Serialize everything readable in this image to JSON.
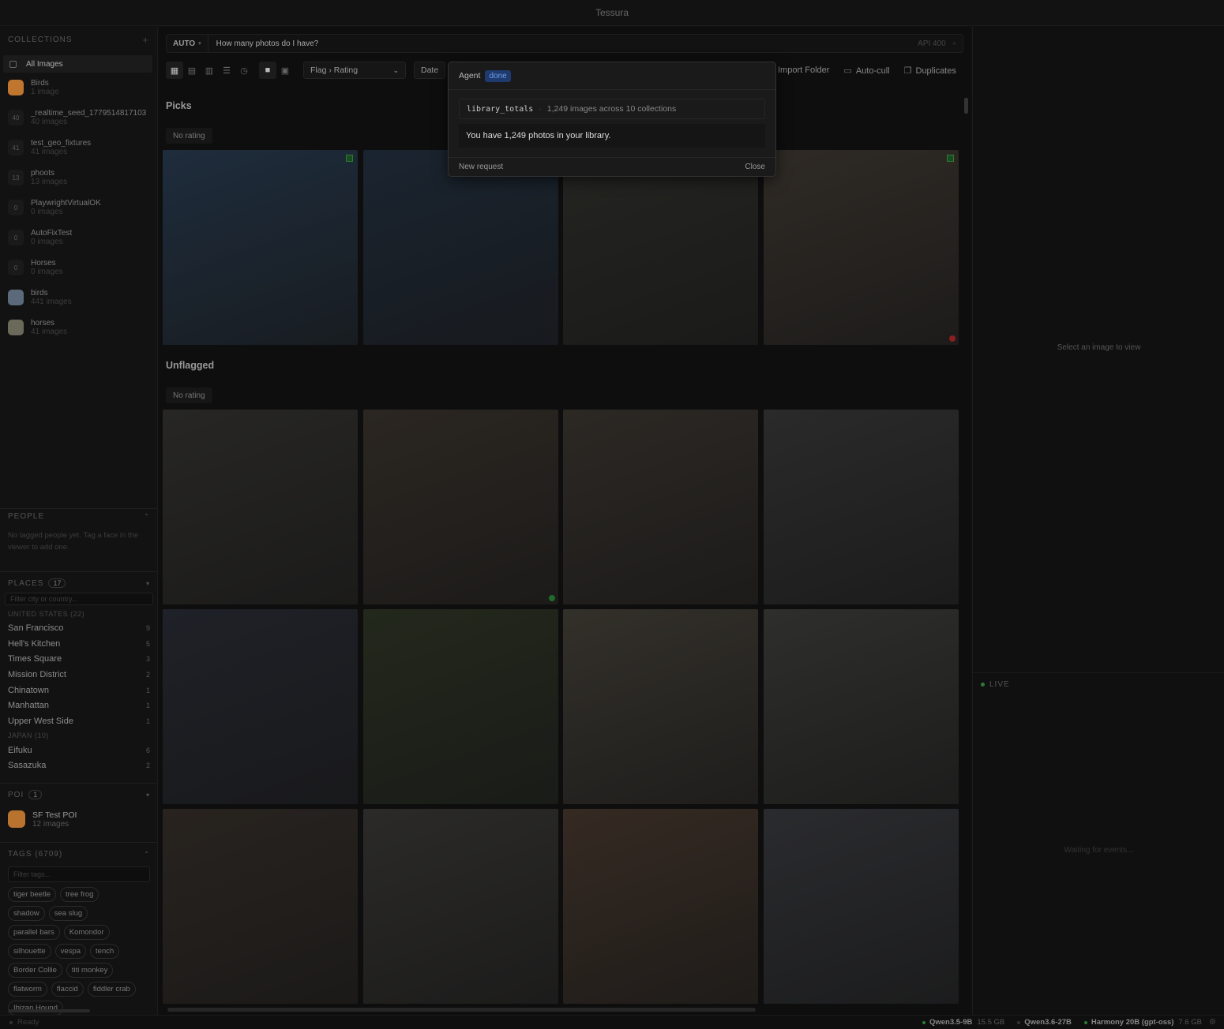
{
  "app": {
    "title": "Tessura"
  },
  "sidebar": {
    "collections_header": "COLLECTIONS",
    "all_images": "All Images",
    "collections": [
      {
        "name": "Birds",
        "count": "1 image",
        "badge": "",
        "color": "#c0762e"
      },
      {
        "name": "_realtime_seed_1779514817103",
        "count": "40 images",
        "badge": "40",
        "color": ""
      },
      {
        "name": "test_geo_fixtures",
        "count": "41 images",
        "badge": "41",
        "color": ""
      },
      {
        "name": "phoots",
        "count": "13 images",
        "badge": "13",
        "color": ""
      },
      {
        "name": "PlaywrightVirtualOK",
        "count": "0 images",
        "badge": "0",
        "color": ""
      },
      {
        "name": "AutoFixTest",
        "count": "0 images",
        "badge": "0",
        "color": ""
      },
      {
        "name": "Horses",
        "count": "0 images",
        "badge": "0",
        "color": ""
      },
      {
        "name": "birds",
        "count": "441 images",
        "badge": "",
        "color": "#5a6a7a"
      },
      {
        "name": "horses",
        "count": "41 images",
        "badge": "",
        "color": "#6a6a5a"
      }
    ],
    "people_header": "PEOPLE",
    "people_empty": "No tagged people yet. Tag a face in the viewer to add one.",
    "places_header": "PLACES",
    "places_count": "17",
    "places_filter_placeholder": "Filter city or country...",
    "countries": [
      {
        "name": "UNITED STATES (22)",
        "places": [
          {
            "name": "San Francisco",
            "count": "9"
          },
          {
            "name": "Hell's Kitchen",
            "count": "5"
          },
          {
            "name": "Times Square",
            "count": "3"
          },
          {
            "name": "Mission District",
            "count": "2"
          },
          {
            "name": "Chinatown",
            "count": "1"
          },
          {
            "name": "Manhattan",
            "count": "1"
          },
          {
            "name": "Upper West Side",
            "count": "1"
          }
        ]
      },
      {
        "name": "JAPAN (10)",
        "places": [
          {
            "name": "Eifuku",
            "count": "6"
          },
          {
            "name": "Sasazuka",
            "count": "2"
          }
        ]
      }
    ],
    "poi_header": "POI",
    "poi_count": "1",
    "poi": {
      "name": "SF Test POI",
      "count": "12 images"
    },
    "tags_header": "TAGS (6709)",
    "tags_filter_placeholder": "Filter tags...",
    "tags": [
      "tiger beetle",
      "tree frog",
      "shadow",
      "sea slug",
      "parallel bars",
      "Komondor",
      "silhouette",
      "vespa",
      "tench",
      "Border Collie",
      "titi monkey",
      "flatworm",
      "flaccid",
      "fiddler crab",
      "Ibizan Hound"
    ]
  },
  "main": {
    "search_mode": "AUTO",
    "search_query": "How many photos do I have?",
    "search_hint": "API 400",
    "sort_value": "Flag › Rating",
    "date_label": "Date",
    "actions": [
      {
        "label": "Import Folder",
        "icon": "folder-icon"
      },
      {
        "label": "Auto-cull",
        "icon": "calendar-icon"
      },
      {
        "label": "Duplicates",
        "icon": "copy-icon"
      }
    ],
    "groups": [
      {
        "title": "Picks",
        "rating_label": "No rating"
      },
      {
        "title": "Unflagged",
        "rating_label": "No rating"
      }
    ],
    "photo_colors": {
      "picks": [
        "#1e2c3c",
        "#1a2430",
        "#242421",
        "#2f2a25"
      ],
      "unflagged": [
        "#272624",
        "#2b2621",
        "#2c2824",
        "#2a2a2a",
        "#1f2128",
        "#23281c",
        "#33302a",
        "#2e2e2c",
        "#28231f",
        "#2b2a28",
        "#352a22",
        "#2a2b2e"
      ]
    }
  },
  "agent": {
    "label": "Agent",
    "status": "done",
    "tool_name": "library_totals",
    "tool_result": "1,249 images across 10 collections",
    "answer": "You have 1,249 photos in your library.",
    "new_request": "New request",
    "close": "Close"
  },
  "right_panel": {
    "viewer_empty": "Select an image to view",
    "live_header": "LIVE",
    "live_waiting": "Waiting for events..."
  },
  "status_bar": {
    "ready": "Ready",
    "models": [
      {
        "name": "Qwen3.5-9B",
        "size": "15.5 GB",
        "active": true
      },
      {
        "name": "Qwen3.6-27B",
        "size": "",
        "active": false
      },
      {
        "name": "Harmony 20B (gpt-oss)",
        "size": "7.6 GB",
        "active": true
      }
    ]
  }
}
